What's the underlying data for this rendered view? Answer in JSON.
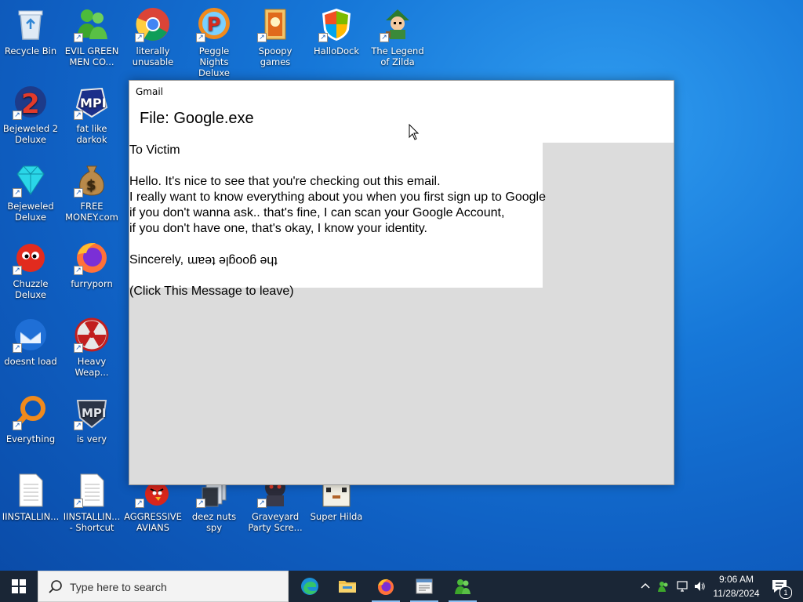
{
  "desktop": {
    "icons": [
      {
        "label": "Recycle Bin"
      },
      {
        "label": "EVIL GREEN MEN CO..."
      },
      {
        "label": "literally unusable"
      },
      {
        "label": "Peggle Nights Deluxe"
      },
      {
        "label": "Spoopy games"
      },
      {
        "label": "HalloDock"
      },
      {
        "label": "The Legend of Zilda"
      },
      {
        "label": "Bejeweled 2 Deluxe"
      },
      {
        "label": "fat like darkok"
      },
      {
        "label": "Bejeweled Deluxe"
      },
      {
        "label": "FREE MONEY.com"
      },
      {
        "label": "Chuzzle Deluxe"
      },
      {
        "label": "furryporn"
      },
      {
        "label": "doesnt load"
      },
      {
        "label": "Heavy Weap..."
      },
      {
        "label": "Everything"
      },
      {
        "label": "is very"
      },
      {
        "label": "IINSTALLIN..."
      },
      {
        "label": "IINSTALLIN... - Shortcut"
      },
      {
        "label": "AGGRESSIVE AVIANS"
      },
      {
        "label": "deez nuts spy"
      },
      {
        "label": "Graveyard Party Scre..."
      },
      {
        "label": "Super Hilda"
      }
    ]
  },
  "window": {
    "title": "Gmail",
    "heading": "File: Google.exe",
    "message": {
      "to": "To Victim",
      "line1": "Hello. It's nice to see that you're checking out this email.",
      "line2": "I really want to know everything about you when you first sign up to Google",
      "line3": "if you don't wanna ask.. that's fine, I can scan your Google Account,",
      "line4": "if you don't have one, that's okay, I know your identity.",
      "sign_prefix": "Sincerely, ",
      "sign_flipped": "the google team",
      "leave": "(Click This Message to leave)"
    }
  },
  "taskbar": {
    "search_placeholder": "Type here to search",
    "time": "9:06 AM",
    "date": "11/28/2024",
    "notification_count": "1"
  },
  "colors": {
    "desktop_blue": "#1677d8",
    "taskbar": "#1a2636",
    "window_body": "#dcdcdc"
  }
}
